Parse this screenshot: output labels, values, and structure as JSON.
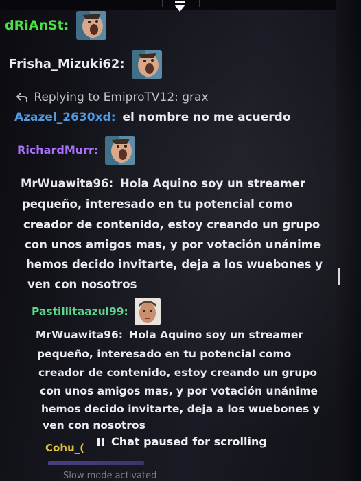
{
  "chat": {
    "messages": [
      {
        "user": "dRiAnSt:",
        "user_color": "#49e243",
        "emote": "screaming-face-emote"
      },
      {
        "user": "Frisha_Mizuki62:",
        "user_color": "#e9ebf2",
        "emote": "screaming-face-emote"
      },
      {
        "reply_prefix": "Replying to EmiproTV12: grax"
      },
      {
        "user": "Azazel_2630xd:",
        "user_color": "#4e9be6",
        "text": "el nombre no me acuerdo"
      },
      {
        "user": "RichardMurr:",
        "user_color": "#a970ff",
        "emote": "screaming-face-emote"
      },
      {
        "user": "MrWuawita96:",
        "user_color": "#e8e8ec",
        "lines": [
          "Hola Aquino soy un streamer",
          "pequeño, interesado en tu potencial como",
          "creador de contenido, estoy creando un grupo",
          "con unos amigos mas, y por votación unánime",
          "hemos decido invitarte, deja a los wuebones y",
          "ven con nosotros"
        ]
      },
      {
        "user": "Pastillitaazul99:",
        "user_color": "#5fd48a",
        "emote": "face-photo-emote"
      },
      {
        "user": "MrWuawita96:",
        "user_color": "#e8e8ec",
        "lines": [
          "Hola Aquino soy un streamer",
          "pequeño, interesado en tu potencial como",
          "creador de contenido, estoy creando un grupo",
          "con unos amigos mas, y por votación unánime",
          "hemos decido invitarte, deja a los wuebones y",
          "ven con nosotros"
        ]
      },
      {
        "user": "Cohu_(",
        "user_color": "#e0c23c"
      }
    ],
    "paused_text": "Chat paused for scrolling",
    "slow_mode_text": "Slow mode activated"
  },
  "colors": {
    "background": "#16161e",
    "text": "#ecebf0"
  }
}
